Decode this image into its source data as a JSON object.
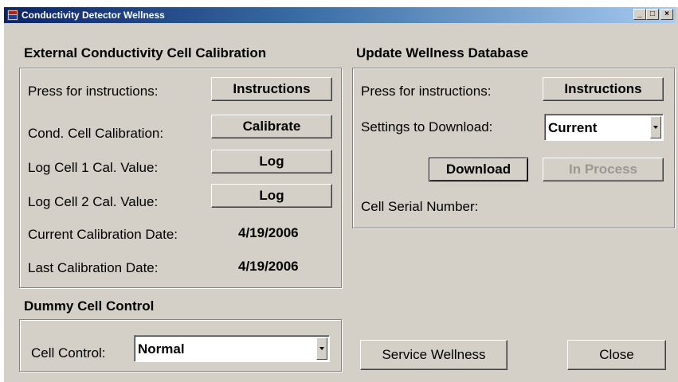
{
  "window": {
    "title": "Conductivity Detector Wellness",
    "minimize": "_",
    "maximize": "□",
    "close": "×"
  },
  "calibration": {
    "title": "External Conductivity Cell Calibration",
    "instructions_label": "Press for instructions:",
    "instructions_button": "Instructions",
    "calibration_label": "Cond. Cell Calibration:",
    "calibrate_button": "Calibrate",
    "log1_label": "Log Cell 1 Cal. Value:",
    "log1_button": "Log",
    "log2_label": "Log Cell 2 Cal. Value:",
    "log2_button": "Log",
    "current_date_label": "Current Calibration Date:",
    "current_date_value": "4/19/2006",
    "last_date_label": "Last Calibration Date:",
    "last_date_value": "4/19/2006"
  },
  "database": {
    "title": "Update Wellness Database",
    "instructions_label": "Press for instructions:",
    "instructions_button": "Instructions",
    "settings_label": "Settings to Download:",
    "settings_value": "Current",
    "download_button": "Download",
    "in_process_button": "In Process",
    "serial_label": "Cell Serial Number:"
  },
  "dummy": {
    "title": "Dummy Cell Control",
    "control_label": "Cell Control:",
    "control_value": "Normal"
  },
  "footer": {
    "service_button": "Service Wellness",
    "close_button": "Close"
  }
}
